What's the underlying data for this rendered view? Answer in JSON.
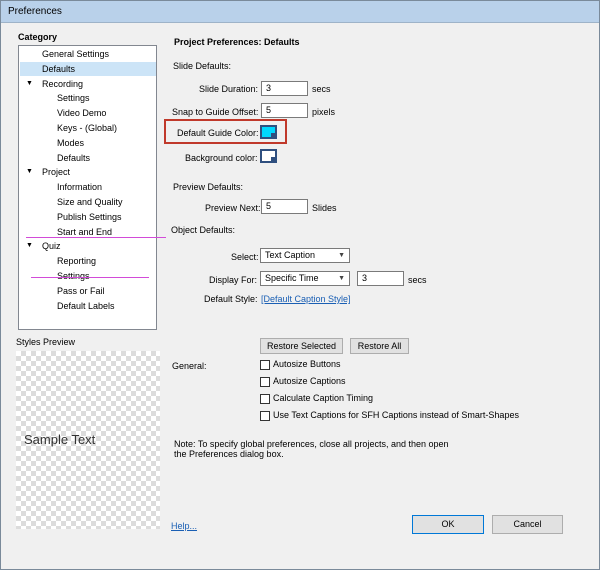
{
  "window": {
    "title": "Preferences"
  },
  "category": {
    "heading": "Category",
    "items": [
      {
        "label": "General Settings",
        "level": 0,
        "expander": false,
        "selected": false
      },
      {
        "label": "Defaults",
        "level": 0,
        "expander": false,
        "selected": true
      },
      {
        "label": "Recording",
        "level": 0,
        "expander": true,
        "selected": false
      },
      {
        "label": "Settings",
        "level": 1,
        "expander": false,
        "selected": false
      },
      {
        "label": "Video Demo",
        "level": 1,
        "expander": false,
        "selected": false
      },
      {
        "label": "Keys - (Global)",
        "level": 1,
        "expander": false,
        "selected": false
      },
      {
        "label": "Modes",
        "level": 1,
        "expander": false,
        "selected": false
      },
      {
        "label": "Defaults",
        "level": 1,
        "expander": false,
        "selected": false
      },
      {
        "label": "Project",
        "level": 0,
        "expander": true,
        "selected": false
      },
      {
        "label": "Information",
        "level": 1,
        "expander": false,
        "selected": false
      },
      {
        "label": "Size and Quality",
        "level": 1,
        "expander": false,
        "selected": false
      },
      {
        "label": "Publish Settings",
        "level": 1,
        "expander": false,
        "selected": false
      },
      {
        "label": "Start and End",
        "level": 1,
        "expander": false,
        "selected": false
      },
      {
        "label": "Quiz",
        "level": 0,
        "expander": true,
        "selected": false
      },
      {
        "label": "Reporting",
        "level": 1,
        "expander": false,
        "selected": false
      },
      {
        "label": "Settings",
        "level": 1,
        "expander": false,
        "selected": false
      },
      {
        "label": "Pass or Fail",
        "level": 1,
        "expander": false,
        "selected": false
      },
      {
        "label": "Default Labels",
        "level": 1,
        "expander": false,
        "selected": false
      }
    ]
  },
  "styles_preview": {
    "label": "Styles Preview",
    "sample": "Sample Text"
  },
  "main": {
    "title": "Project Preferences: Defaults",
    "slide_defaults": {
      "heading": "Slide Defaults:",
      "slide_duration_label": "Slide Duration:",
      "slide_duration_value": "3",
      "slide_duration_unit": "secs",
      "snap_label": "Snap to Guide Offset:",
      "snap_value": "5",
      "snap_unit": "pixels",
      "guide_color_label": "Default Guide Color:",
      "guide_color": "#00d8ff",
      "bg_color_label": "Background color:",
      "bg_color": "#ffffff"
    },
    "preview_defaults": {
      "heading": "Preview Defaults:",
      "preview_next_label": "Preview Next:",
      "preview_next_value": "5",
      "preview_next_unit": "Slides"
    },
    "object_defaults": {
      "heading": "Object Defaults:",
      "select_label": "Select:",
      "select_value": "Text Caption",
      "display_for_label": "Display For:",
      "display_for_value": "Specific Time",
      "display_for_time": "3",
      "display_for_unit": "secs",
      "default_style_label": "Default Style:",
      "default_style_value": "[Default Caption Style]"
    },
    "restore_selected": "Restore Selected",
    "restore_all": "Restore All",
    "general": {
      "heading": "General:",
      "options": [
        {
          "label": "Autosize Buttons",
          "checked": false
        },
        {
          "label": "Autosize Captions",
          "checked": false
        },
        {
          "label": "Calculate Caption Timing",
          "checked": false
        },
        {
          "label": "Use Text Captions for SFH Captions instead of Smart-Shapes",
          "checked": false
        }
      ]
    },
    "note_line1": "Note: To specify global preferences, close all projects, and then open",
    "note_line2": "the Preferences dialog box."
  },
  "footer": {
    "help": "Help...",
    "ok": "OK",
    "cancel": "Cancel"
  }
}
